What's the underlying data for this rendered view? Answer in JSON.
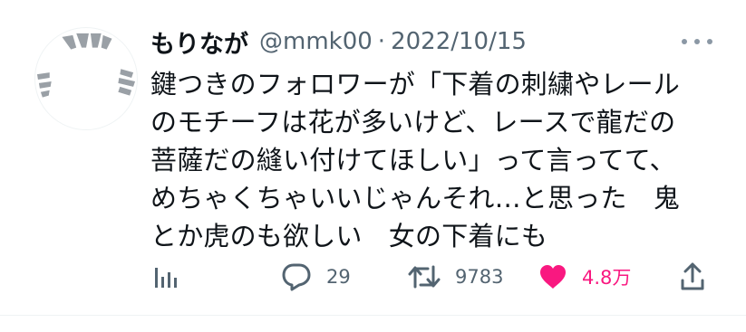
{
  "colors": {
    "text": "#0f1419",
    "secondary": "#536471",
    "like_active": "#f91880",
    "divider": "#eff3f4"
  },
  "tweet": {
    "author": {
      "display_name": "もりなが",
      "handle": "@mmk00",
      "separator": "·",
      "date": "2022/10/15",
      "avatar_icon": "cat-stripes-avatar"
    },
    "text_lines": [
      "鍵つきのフォロワーが「下着の刺繍やレール",
      "のモチーフは花が多いけど、レースで龍だの",
      "菩薩だの縫い付けてほしい」って言ってて、",
      "めちゃくちゃいいじゃんそれ…と思った　鬼",
      "とか虎のも欲しい　女の下着にも"
    ],
    "actions": {
      "analytics": {
        "icon": "bar-chart-icon"
      },
      "reply": {
        "icon": "reply-bubble-icon",
        "count": "29"
      },
      "retweet": {
        "icon": "retweet-icon",
        "count": "9783"
      },
      "like": {
        "icon": "heart-filled-icon",
        "count": "4.8万",
        "liked": true
      },
      "share": {
        "icon": "share-upload-icon"
      }
    },
    "more_icon": "more-dots-icon"
  }
}
